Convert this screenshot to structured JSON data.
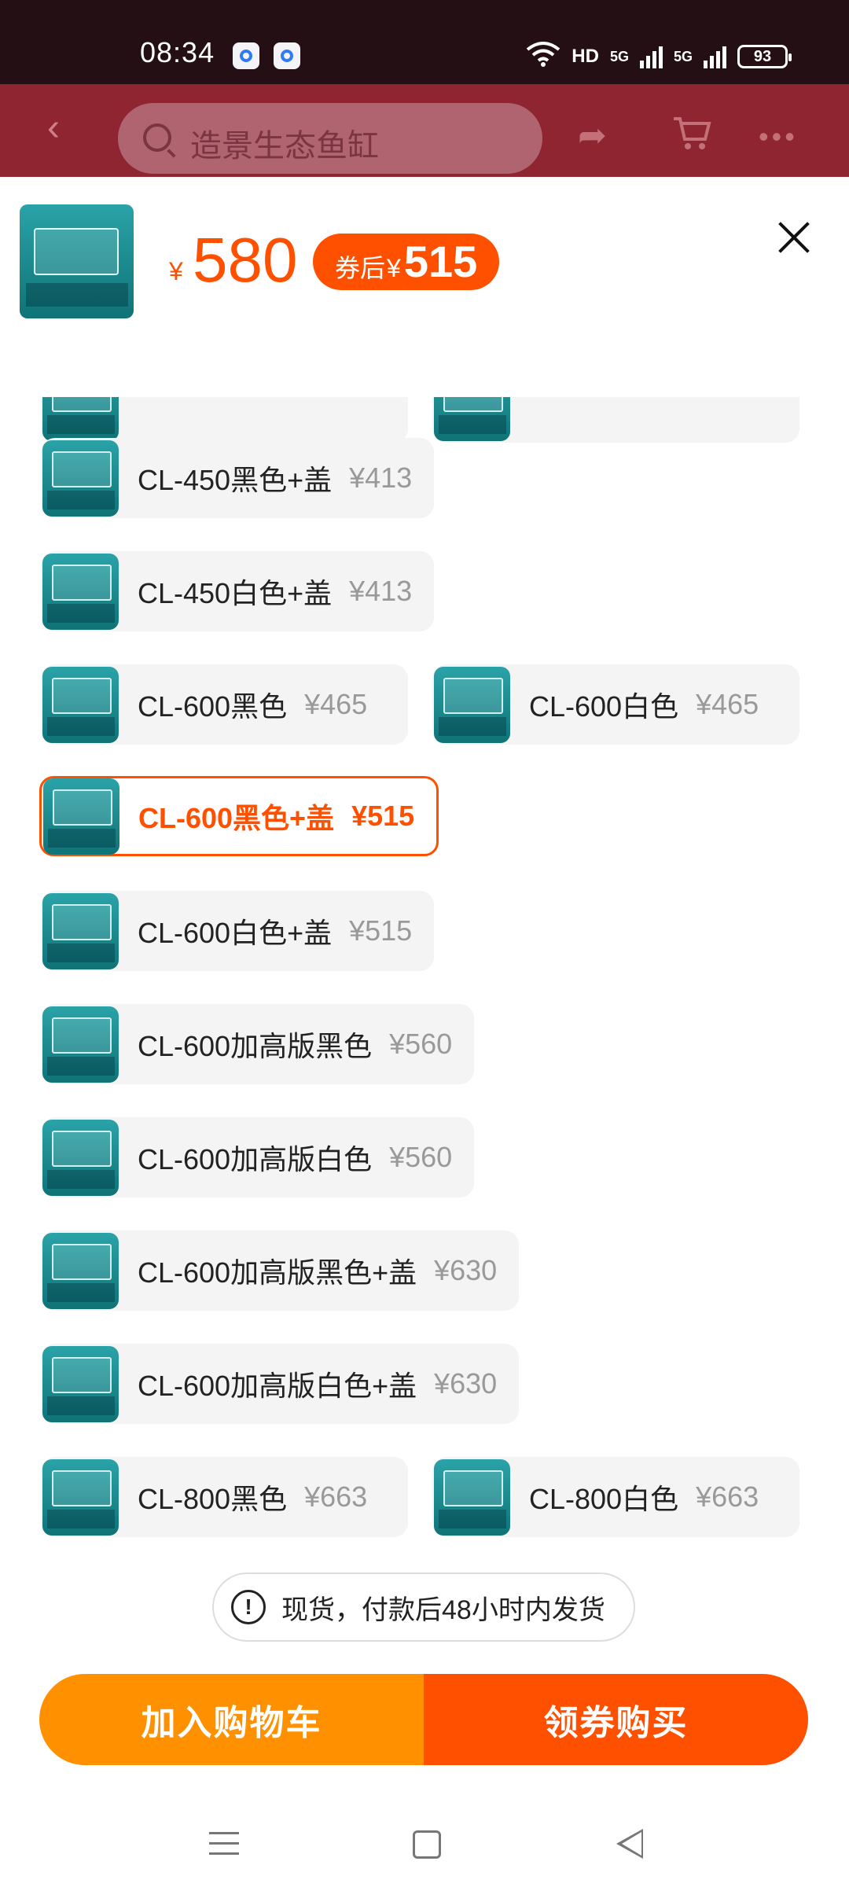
{
  "status_bar": {
    "time": "08:34",
    "battery": "93",
    "hd_label": "HD",
    "network_1": "5G",
    "network_2": "5G"
  },
  "top_nav": {
    "search_placeholder": "造景生态鱼缸"
  },
  "header": {
    "currency": "¥",
    "price": "580",
    "coupon_label": "券后",
    "coupon_currency": "¥",
    "coupon_price": "515"
  },
  "options": [
    {
      "name": "CL-450黑色+盖",
      "price": "¥413",
      "selected": false
    },
    {
      "name": "CL-450白色+盖",
      "price": "¥413",
      "selected": false
    },
    {
      "name": "CL-600黑色",
      "price": "¥465",
      "selected": false
    },
    {
      "name": "CL-600白色",
      "price": "¥465",
      "selected": false
    },
    {
      "name": "CL-600黑色+盖",
      "price": "¥515",
      "selected": true
    },
    {
      "name": "CL-600白色+盖",
      "price": "¥515",
      "selected": false
    },
    {
      "name": "CL-600加高版黑色",
      "price": "¥560",
      "selected": false
    },
    {
      "name": "CL-600加高版白色",
      "price": "¥560",
      "selected": false
    },
    {
      "name": "CL-600加高版黑色+盖",
      "price": "¥630",
      "selected": false
    },
    {
      "name": "CL-600加高版白色+盖",
      "price": "¥630",
      "selected": false
    },
    {
      "name": "CL-800黑色",
      "price": "¥663",
      "selected": false
    },
    {
      "name": "CL-800白色",
      "price": "¥663",
      "selected": false
    }
  ],
  "shipping_notice": "现货，付款后48小时内发货",
  "actions": {
    "add_to_cart": "加入购物车",
    "buy_with_coupon": "领券购买"
  },
  "colors": {
    "accent": "#ff5000",
    "cart": "#ff9000"
  }
}
